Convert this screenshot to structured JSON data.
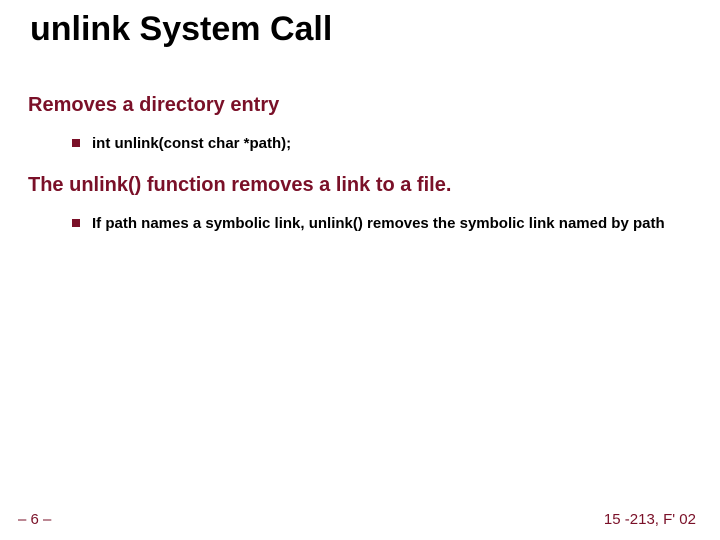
{
  "title": "unlink System Call",
  "subhead1": "Removes a directory entry",
  "bullet1": "int unlink(const char *path);",
  "subhead2": "The unlink() function removes a link  to  a  file.",
  "bullet2": "If  path names a symbolic link, unlink() removes the symbolic link named by path",
  "footer": {
    "page": "– 6 –",
    "course": "15 -213, F' 02"
  }
}
